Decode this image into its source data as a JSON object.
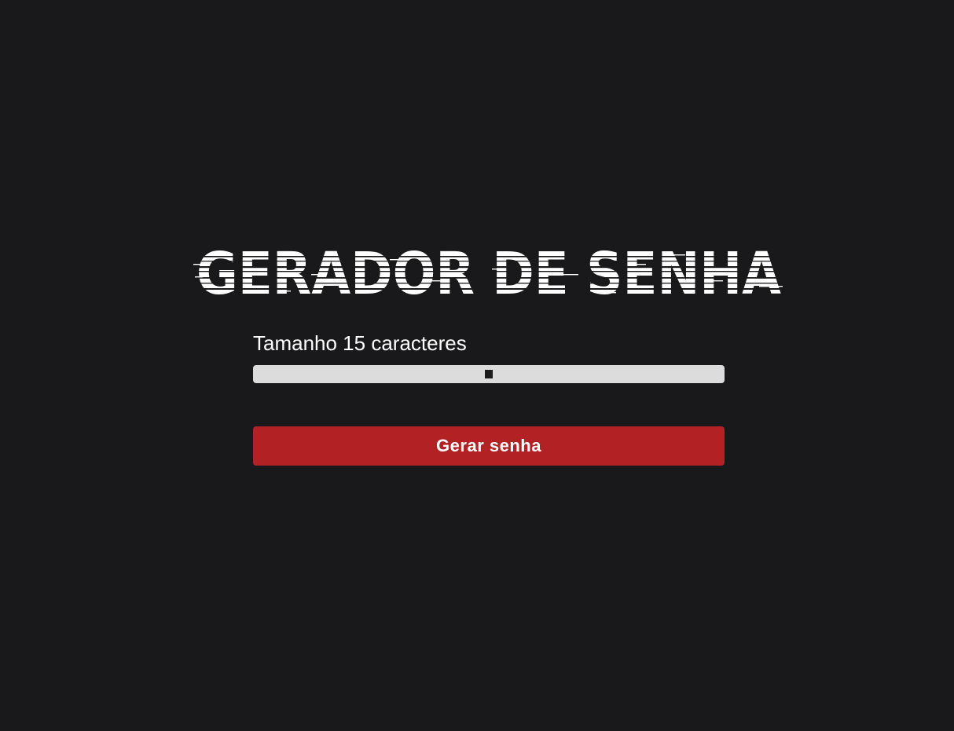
{
  "app": {
    "title": "GERADOR DE SENHA"
  },
  "length": {
    "prefix": "Tamanho",
    "value": 15,
    "suffix": "caracteres",
    "label": "Tamanho 15 caracteres",
    "slider_fraction": 0.5
  },
  "actions": {
    "generate_label": "Gerar senha"
  },
  "colors": {
    "background": "#19191b",
    "accent": "#b22123",
    "track": "#dcdcdc",
    "thumb": "#1c1c1c",
    "text": "#ffffff"
  }
}
